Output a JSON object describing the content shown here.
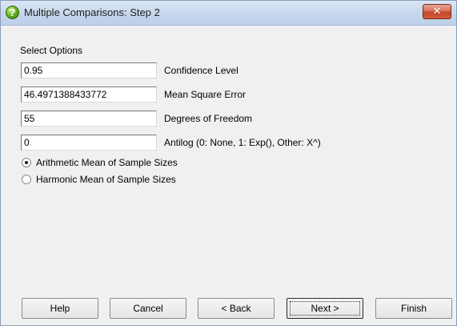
{
  "window": {
    "title": "Multiple Comparisons: Step 2",
    "close_symbol": "✕",
    "title_icon": "question-icon",
    "title_icon_glyph": "?"
  },
  "section": {
    "label": "Select Options"
  },
  "fields": [
    {
      "value": "0.95",
      "label": "Confidence Level"
    },
    {
      "value": "46.4971388433772",
      "label": "Mean Square Error"
    },
    {
      "value": "55",
      "label": "Degrees of Freedom"
    },
    {
      "value": "0",
      "label": "Antilog (0: None, 1: Exp(), Other: X^)"
    }
  ],
  "radios": [
    {
      "label": "Arithmetic Mean of Sample Sizes",
      "checked": true
    },
    {
      "label": "Harmonic Mean of Sample Sizes",
      "checked": false
    }
  ],
  "buttons": [
    {
      "label": "Help"
    },
    {
      "label": "Cancel"
    },
    {
      "label": "< Back"
    },
    {
      "label": "Next >",
      "default": true
    },
    {
      "label": "Finish"
    }
  ]
}
